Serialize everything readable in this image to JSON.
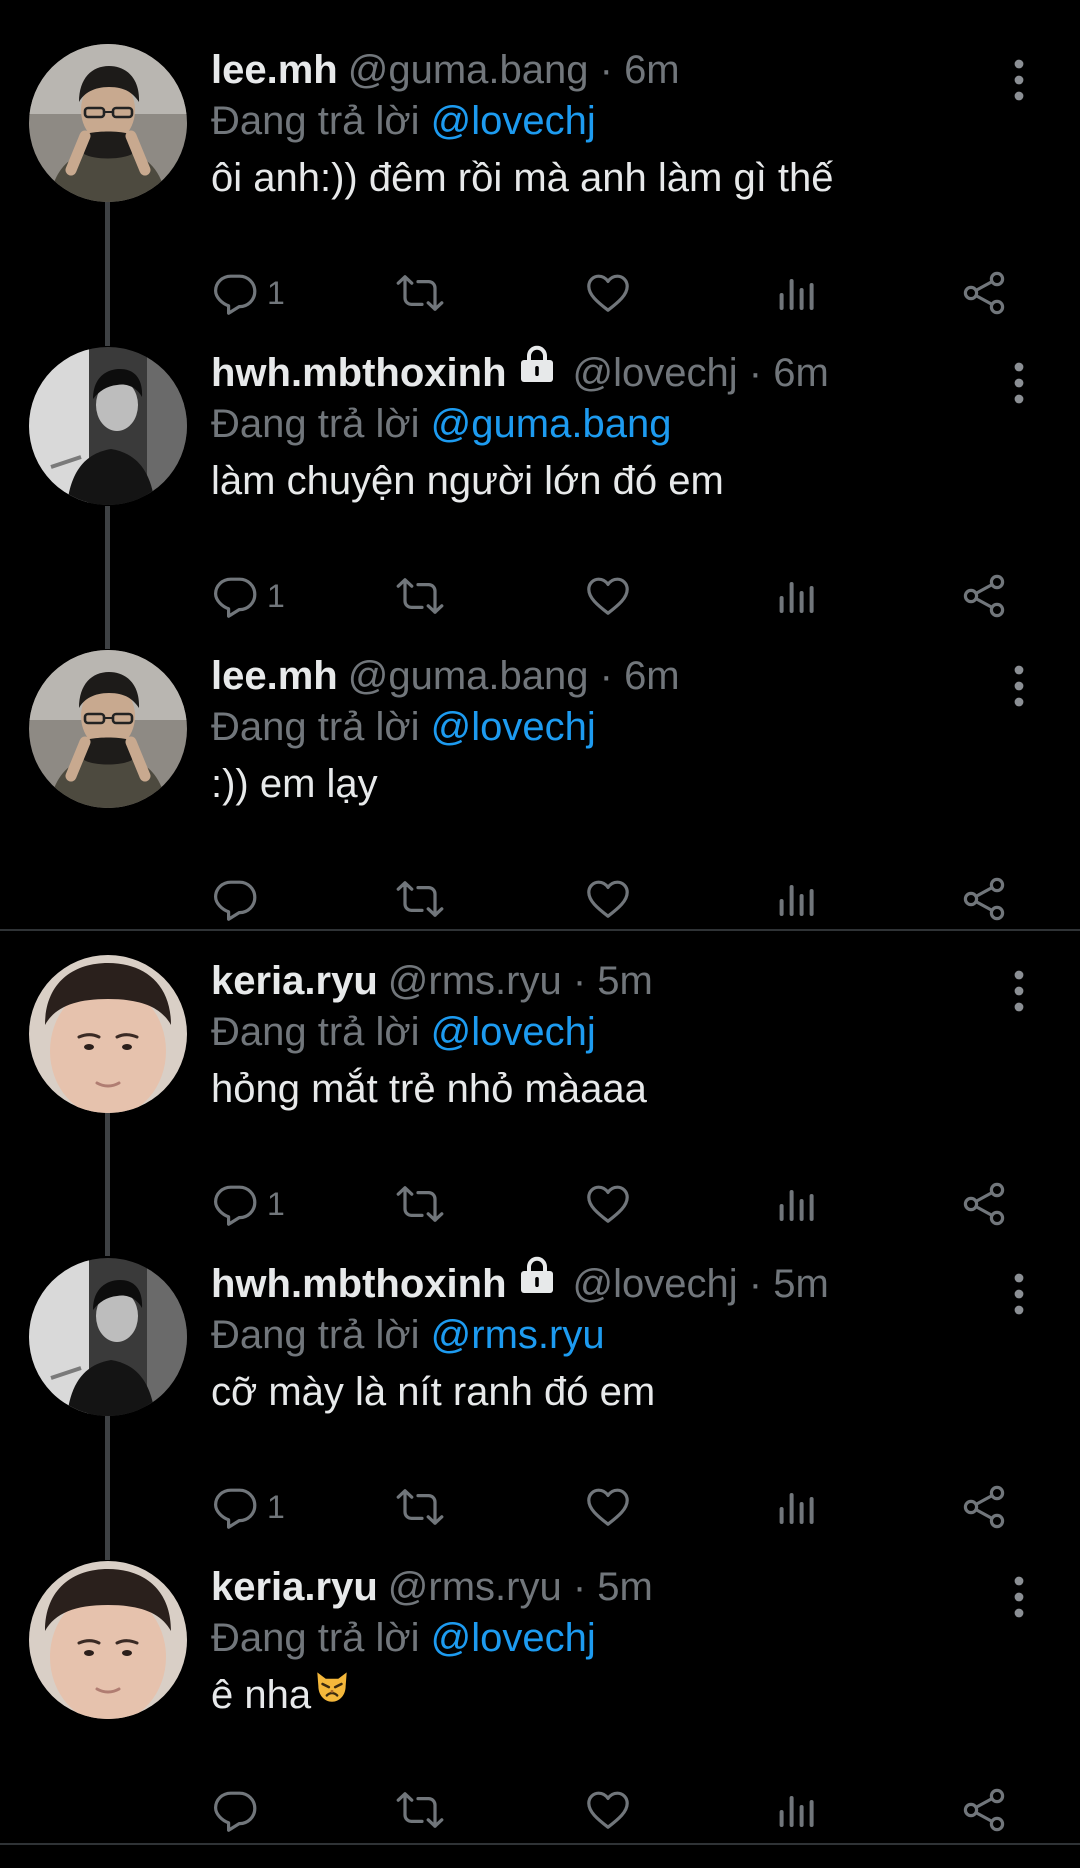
{
  "reply_prefix": "Đang trả lời",
  "tweets": [
    {
      "name": "lee.mh",
      "handle": "@guma.bang",
      "dot": "·",
      "time": "6m",
      "reply_to": "@lovechj",
      "text": "ôi anh:)) đêm rồi mà anh làm gì thế",
      "reply_count": "1",
      "locked": false,
      "avatar": "avatar-lee"
    },
    {
      "name": "hwh.mbthoxinh",
      "handle": "@lovechj",
      "dot": "·",
      "time": "6m",
      "reply_to": "@guma.bang",
      "text": "làm chuyện người lớn đó em",
      "reply_count": "1",
      "locked": true,
      "avatar": "avatar-hwh"
    },
    {
      "name": "lee.mh",
      "handle": "@guma.bang",
      "dot": "·",
      "time": "6m",
      "reply_to": "@lovechj",
      "text": ":)) em lạy",
      "reply_count": "",
      "locked": false,
      "avatar": "avatar-lee"
    },
    {
      "name": "keria.ryu",
      "handle": "@rms.ryu",
      "dot": "·",
      "time": "5m",
      "reply_to": "@lovechj",
      "text": "hỏng mắt trẻ nhỏ màaaa",
      "reply_count": "1",
      "locked": false,
      "avatar": "avatar-keria"
    },
    {
      "name": "hwh.mbthoxinh",
      "handle": "@lovechj",
      "dot": "·",
      "time": "5m",
      "reply_to": "@rms.ryu",
      "text": "cỡ mày là nít ranh đó em",
      "reply_count": "1",
      "locked": true,
      "avatar": "avatar-hwh"
    },
    {
      "name": "keria.ryu",
      "handle": "@rms.ryu",
      "dot": "·",
      "time": "5m",
      "reply_to": "@lovechj",
      "text": "ê nha",
      "emoji": "pouting-cat-emoji",
      "reply_count": "",
      "locked": false,
      "avatar": "avatar-keria"
    }
  ],
  "icons": {
    "reply": "reply-icon",
    "retweet": "retweet-icon",
    "like": "like-icon",
    "views": "views-icon",
    "share": "share-icon",
    "more": "more-icon",
    "lock": "lock-icon"
  },
  "colors": {
    "background": "#000000",
    "text": "#e7e9ea",
    "secondary": "#71767b",
    "link": "#1d9bf0",
    "divider": "#2f3336",
    "thread_line": "#3e4144"
  }
}
